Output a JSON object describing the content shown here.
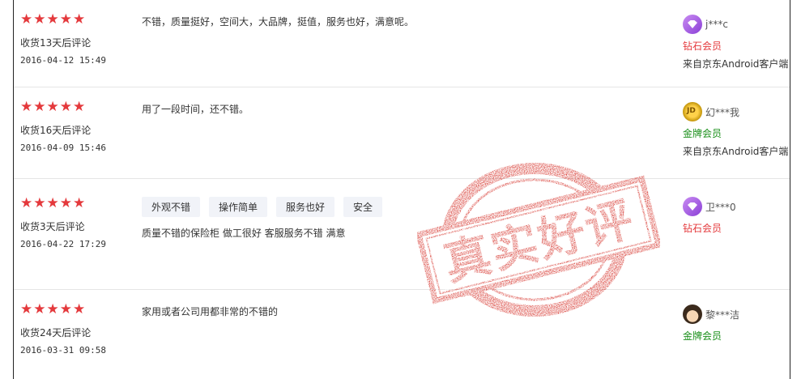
{
  "colors": {
    "star": "#e4393c",
    "diamond_member": "#e4393c",
    "gold_member": "#1a8f1a",
    "stamp": "#d42a22"
  },
  "reviews": [
    {
      "stars": 5,
      "after_days": "收货13天后评论",
      "date": "2016-04-12 15:49",
      "comment": "不错，质量挺好，空间大，大品牌，挺值，服务也好，满意呢。",
      "tags": [],
      "user": "j***c",
      "avatar_icon": "diamond-avatar-icon",
      "level": "钻石会员",
      "client": "来自京东Android客户端"
    },
    {
      "stars": 5,
      "after_days": "收货16天后评论",
      "date": "2016-04-09 15:46",
      "comment": "用了一段时间，还不错。",
      "tags": [],
      "user": "幻***我",
      "avatar_icon": "jd-gold-avatar-icon",
      "level": "金牌会员",
      "client": "来自京东Android客户端"
    },
    {
      "stars": 5,
      "after_days": "收货3天后评论",
      "date": "2016-04-22 17:29",
      "comment": "质量不错的保险柜 做工很好 客服服务不错 满意",
      "tags": [
        "外观不错",
        "操作简单",
        "服务也好",
        "安全"
      ],
      "user": "卫***0",
      "avatar_icon": "diamond-avatar-icon",
      "level": "钻石会员",
      "client": ""
    },
    {
      "stars": 5,
      "after_days": "收货24天后评论",
      "date": "2016-03-31 09:58",
      "comment": "家用或者公司用都非常的不错的",
      "tags": [],
      "user": "黎***洁",
      "avatar_icon": "girl-avatar-icon",
      "level": "金牌会员",
      "client": ""
    }
  ],
  "stamp": {
    "text": "真实好评",
    "icon": "red-rubber-stamp"
  }
}
